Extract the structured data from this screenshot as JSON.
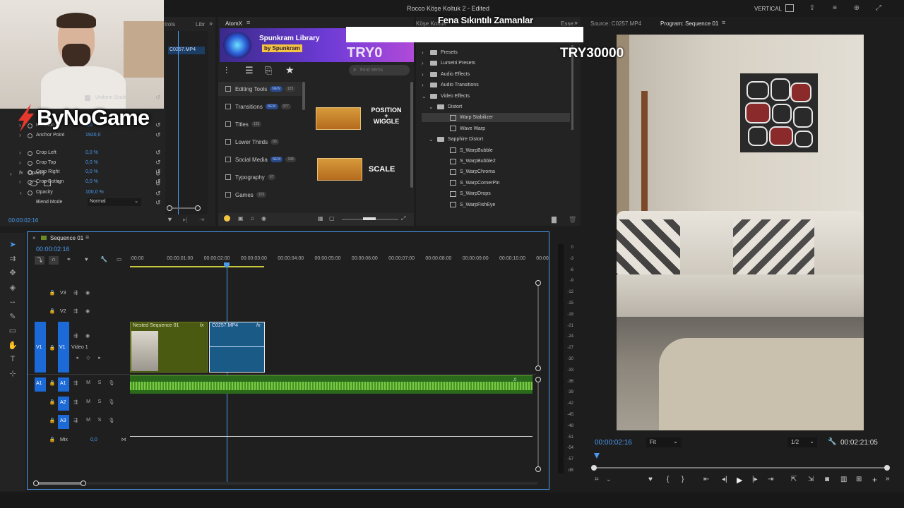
{
  "window": {
    "title": "Rocco Köşe Koltuk 2 - Edited",
    "workspace_label": "VERTICAL"
  },
  "overlays": {
    "song_title": "Fena Sıkıntılı Zamanlar",
    "promo_code": "TRY30000",
    "brand_logo_text": "ByNoGame",
    "brand_accent_color": "#e8382e"
  },
  "effect_controls": {
    "tab_label": "trols",
    "tab2_label": "Libr",
    "uniform_scale_label": "Uniform Scale",
    "properties": [
      {
        "label": "Rotation",
        "value": "0,0"
      },
      {
        "label": "Anchor Point",
        "value": "1920,0"
      },
      {
        "label": "Crop Left",
        "value": "0,0 %"
      },
      {
        "label": "Crop Top",
        "value": "0,0 %"
      },
      {
        "label": "Crop Right",
        "value": "0,0 %"
      },
      {
        "label": "Crop Bottom",
        "value": "0,0 %"
      }
    ],
    "opacity_group_label": "Opacity",
    "opacity_label": "Opacity",
    "opacity_value": "100,0 %",
    "blend_mode_label": "Blend Mode",
    "blend_mode_value": "Normal",
    "clip_chip_label": "C0257.MP4",
    "timecode": "00:00:02:16"
  },
  "atomx": {
    "tab_label": "AtomX",
    "library_title": "Spunkram Library",
    "library_subtitle": "by Spunkram",
    "banner_text": "TRY0",
    "search_placeholder": "Find items",
    "categories": [
      {
        "label": "Editing Tools",
        "badge": "NEW",
        "count": "125"
      },
      {
        "label": "Transitions",
        "badge": "NEW",
        "count": "377"
      },
      {
        "label": "Titles",
        "badge": "",
        "count": "133"
      },
      {
        "label": "Lower Thirds",
        "badge": "",
        "count": "80"
      },
      {
        "label": "Social Media",
        "badge": "NEW",
        "count": "188"
      },
      {
        "label": "Typography",
        "badge": "",
        "count": "67"
      },
      {
        "label": "Games",
        "badge": "",
        "count": "103"
      }
    ],
    "items": [
      {
        "label": "POSITION\n+\nWIGGLE"
      },
      {
        "label": "SCALE"
      }
    ]
  },
  "effects_panel": {
    "tabs": [
      "Köşe Koltuk",
      "Esse"
    ],
    "tree": [
      {
        "label": "Presets",
        "level": 0,
        "type": "folder",
        "expanded": false
      },
      {
        "label": "Lumetri Presets",
        "level": 0,
        "type": "folder",
        "expanded": false
      },
      {
        "label": "Audio Effects",
        "level": 0,
        "type": "folder",
        "expanded": false
      },
      {
        "label": "Audio Transitions",
        "level": 0,
        "type": "folder",
        "expanded": false
      },
      {
        "label": "Video Effects",
        "level": 0,
        "type": "folder",
        "expanded": true
      },
      {
        "label": "Distort",
        "level": 1,
        "type": "folder",
        "expanded": true
      },
      {
        "label": "Warp Stabilizer",
        "level": 2,
        "type": "effect",
        "selected": true
      },
      {
        "label": "Wave Warp",
        "level": 2,
        "type": "effect"
      },
      {
        "label": "Sapphire Distort",
        "level": 1,
        "type": "folder",
        "expanded": true
      },
      {
        "label": "S_WarpBubble",
        "level": 2,
        "type": "effect"
      },
      {
        "label": "S_WarpBubble2",
        "level": 2,
        "type": "effect"
      },
      {
        "label": "S_WarpChroma",
        "level": 2,
        "type": "effect"
      },
      {
        "label": "S_WarpCornerPin",
        "level": 2,
        "type": "effect"
      },
      {
        "label": "S_WarpDrops",
        "level": 2,
        "type": "effect"
      },
      {
        "label": "S_WarpFishEye",
        "level": 2,
        "type": "effect"
      }
    ]
  },
  "source_monitor": {
    "tab_label": "Source: C0257.MP4"
  },
  "program_monitor": {
    "tab_label": "Program: Sequence 01",
    "timecode": "00:00:02:16",
    "fit_label": "Fit",
    "resolution_label": "1/2",
    "duration": "00:02:21:05"
  },
  "timeline": {
    "sequence_tab": "Sequence 01",
    "timecode": "00:00:02:16",
    "ruler_labels": [
      ":00:00",
      "00:00:01:00",
      "00:00:02:00",
      "00:00:03:00",
      "00:00:04:00",
      "00:00:05:00",
      "00:00:06:00",
      "00:00:07:00",
      "00:00:08:00",
      "00:00:09:00",
      "00:00:10:00",
      "00:00"
    ],
    "video_tracks": [
      {
        "name": "V3",
        "label": ""
      },
      {
        "name": "V2",
        "label": ""
      },
      {
        "name": "V1",
        "label": "Video 1"
      }
    ],
    "audio_tracks": [
      {
        "name": "A1"
      },
      {
        "name": "A2"
      },
      {
        "name": "A3"
      }
    ],
    "mix_label": "Mix",
    "mix_value": "0,0",
    "clips": [
      {
        "name": "Nested Sequence 01",
        "track": "V1",
        "fx": "fx"
      },
      {
        "name": "C0257.MP4",
        "track": "V1",
        "fx": "fx"
      }
    ],
    "meter_labels": [
      "0",
      "-3",
      "-6",
      "-9",
      "-12",
      "-15",
      "-18",
      "-21",
      "-24",
      "-27",
      "-30",
      "-33",
      "-36",
      "-39",
      "-42",
      "-45",
      "-48",
      "-51",
      "-54",
      "-57",
      "dB"
    ],
    "track_buttons": {
      "mute": "M",
      "solo": "S"
    }
  }
}
